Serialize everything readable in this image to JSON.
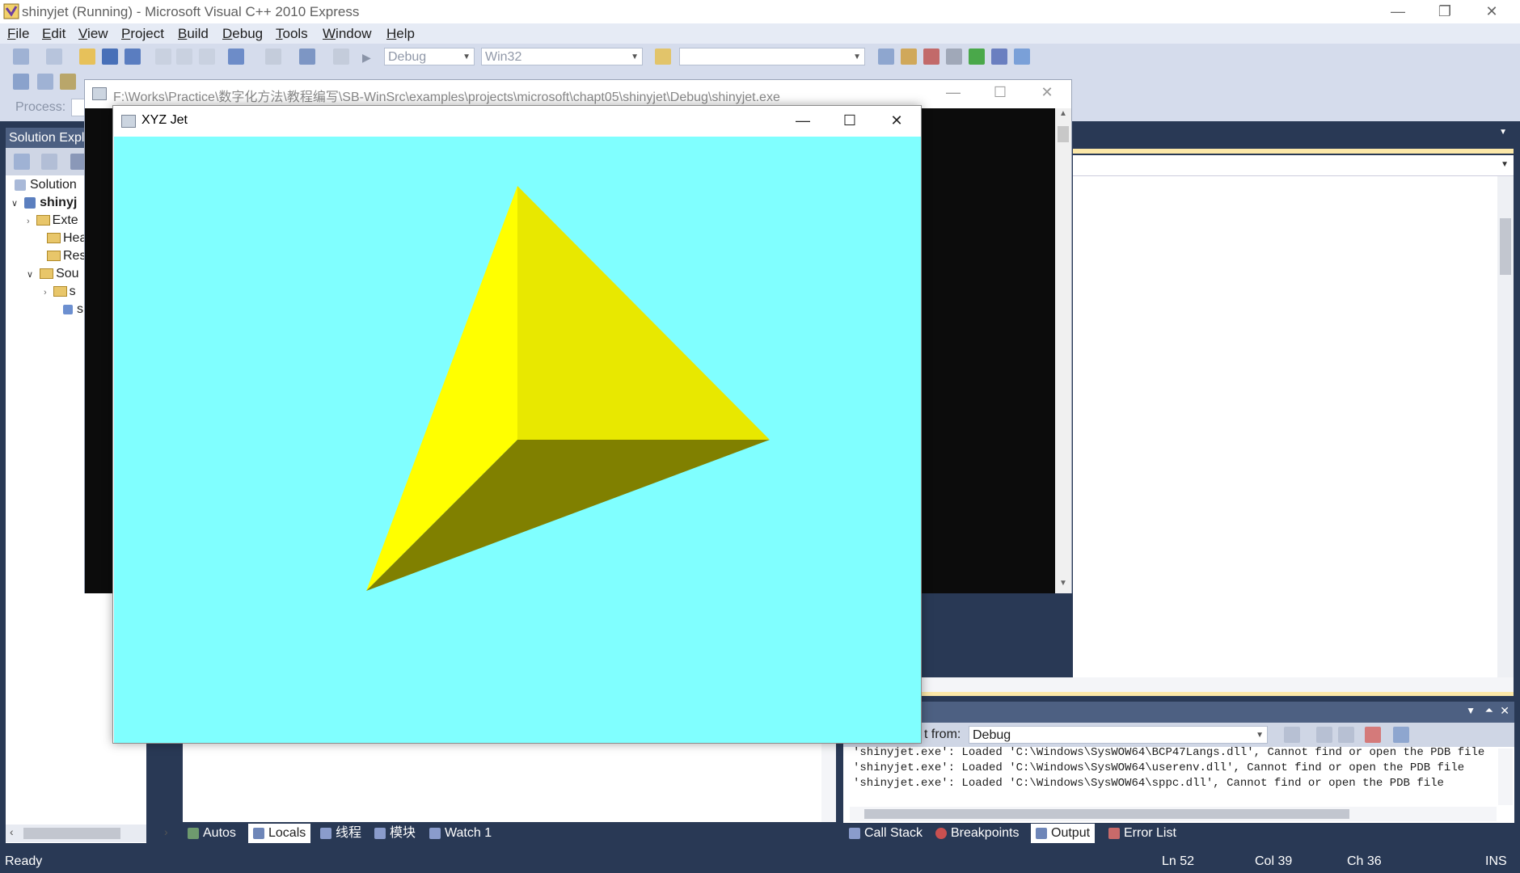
{
  "vs": {
    "title": "shinyjet (Running) - Microsoft Visual C++ 2010 Express",
    "menu": [
      "File",
      "Edit",
      "View",
      "Project",
      "Build",
      "Debug",
      "Tools",
      "Window",
      "Help"
    ],
    "toolbar": {
      "config": "Debug",
      "platform": "Win32",
      "find_value": "",
      "process_label": "Process:"
    },
    "solution_explorer": {
      "header": "Solution Expl",
      "items": [
        {
          "label": "Solution"
        },
        {
          "label": "shinyj"
        },
        {
          "label": "Exte"
        },
        {
          "label": "Hea"
        },
        {
          "label": "Res"
        },
        {
          "label": "Sou"
        },
        {
          "label": "s"
        },
        {
          "label": "s"
        }
      ]
    },
    "console": {
      "title": "F:\\Works\\Practice\\数字化方法\\教程编写\\SB-WinSrc\\examples\\projects\\microsoft\\chapt05\\shinyjet\\Debug\\shinyjet.exe"
    },
    "gl_window": {
      "title": "XYZ Jet",
      "bg_color": "#80ffff",
      "face_colors": {
        "left": "#ffff00",
        "right": "#e8e800",
        "bottom": "#808000"
      }
    },
    "output": {
      "show_label": "t from:",
      "source": "Debug",
      "lines": [
        "'shinyjet.exe': Loaded 'C:\\Windows\\SysWOW64\\BCP47Langs.dll', Cannot find or open the PDB file",
        "'shinyjet.exe': Loaded 'C:\\Windows\\SysWOW64\\userenv.dll', Cannot find or open the PDB file",
        "'shinyjet.exe': Loaded 'C:\\Windows\\SysWOW64\\sppc.dll', Cannot find or open the PDB file"
      ]
    },
    "left_tabs": [
      {
        "label": "Autos",
        "active": false
      },
      {
        "label": "Locals",
        "active": true
      },
      {
        "label": "线程",
        "active": false
      },
      {
        "label": "模块",
        "active": false
      },
      {
        "label": "Watch 1",
        "active": false
      }
    ],
    "right_tabs": [
      {
        "label": "Call Stack",
        "active": false
      },
      {
        "label": "Breakpoints",
        "active": false
      },
      {
        "label": "Output",
        "active": true
      },
      {
        "label": "Error List",
        "active": false
      }
    ],
    "status": {
      "state": "Ready",
      "line": "Ln 52",
      "col": "Col 39",
      "ch": "Ch 36",
      "mode": "INS"
    }
  }
}
